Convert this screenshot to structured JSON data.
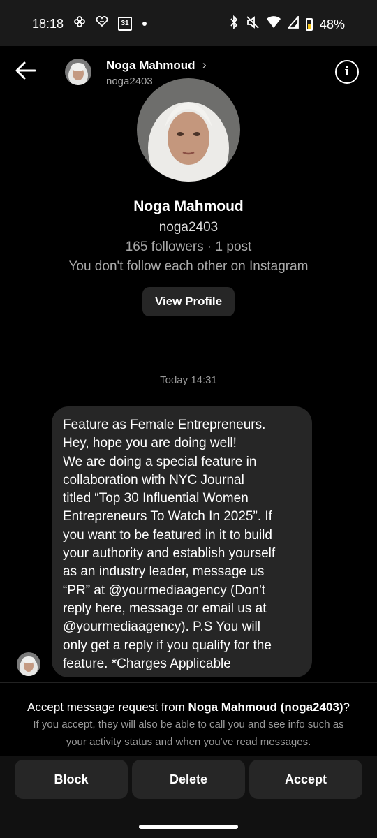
{
  "status_bar": {
    "time": "18:18",
    "battery": "48%",
    "icons": [
      "pinwheel-icon",
      "heart-icon",
      "calendar-icon",
      "dot-icon",
      "bluetooth-icon",
      "mute-icon",
      "wifi-icon",
      "signal-icon",
      "battery-icon"
    ],
    "calendar_day": "31"
  },
  "header": {
    "name": "Noga Mahmoud",
    "username": "noga2403"
  },
  "profile": {
    "name": "Noga Mahmoud",
    "username": "noga2403",
    "stats": "165 followers · 1 post",
    "follow_status": "You don't follow each other on Instagram",
    "view_button": "View Profile"
  },
  "conversation": {
    "timestamp": "Today 14:31",
    "message_lines": [
      "Feature as Female Entrepreneurs.",
      "Hey, hope you are doing well!",
      "We are doing a special feature in",
      "collaboration with NYC Journal",
      "titled “Top 30 Influential Women",
      "Entrepreneurs To Watch In 2025”.  If",
      "you want to be featured in it to build",
      "your authority and establish yourself",
      "as an industry leader, message us",
      "“PR” at @yourmediaagency (Don't",
      "reply here, message or email us at",
      "@yourmediaagency). P.S You will",
      "only get a reply if you qualify for the",
      "feature. *Charges Applicable"
    ]
  },
  "request": {
    "title_prefix": "Accept message request from ",
    "title_name": "Noga Mahmoud (noga2403)",
    "title_suffix": "?",
    "desc_line1": "If you accept, they will also be able to call you and see info such as",
    "desc_line2": "your activity status and when you've read messages."
  },
  "actions": {
    "block": "Block",
    "delete": "Delete",
    "accept": "Accept"
  }
}
